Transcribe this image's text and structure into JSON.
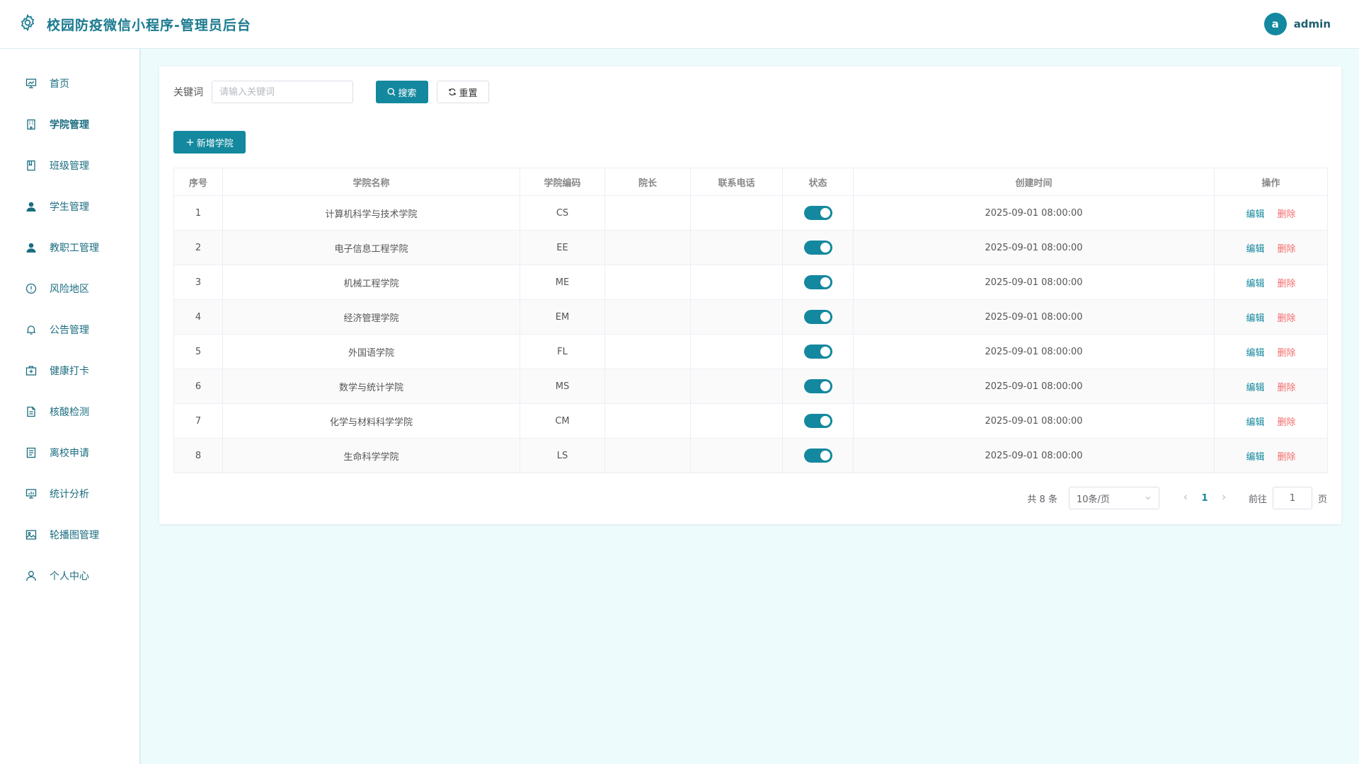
{
  "header": {
    "title": "校园防疫微信小程序-管理员后台",
    "avatar_letter": "a",
    "username": "admin"
  },
  "colors": {
    "primary": "#13889e",
    "danger": "#f56c6c",
    "page_bg": "#eefbfd"
  },
  "sidebar": {
    "items": [
      {
        "label": "首页",
        "icon": "dashboard-icon"
      },
      {
        "label": "学院管理",
        "icon": "building-icon"
      },
      {
        "label": "班级管理",
        "icon": "book-icon"
      },
      {
        "label": "学生管理",
        "icon": "user-icon"
      },
      {
        "label": "教职工管理",
        "icon": "user-icon"
      },
      {
        "label": "风险地区",
        "icon": "warning-circle-icon"
      },
      {
        "label": "公告管理",
        "icon": "bell-icon"
      },
      {
        "label": "健康打卡",
        "icon": "medical-kit-icon"
      },
      {
        "label": "核酸检测",
        "icon": "document-icon"
      },
      {
        "label": "离校申请",
        "icon": "list-document-icon"
      },
      {
        "label": "统计分析",
        "icon": "chart-board-icon"
      },
      {
        "label": "轮播图管理",
        "icon": "image-icon"
      },
      {
        "label": "个人中心",
        "icon": "person-outline-icon"
      }
    ]
  },
  "search": {
    "label": "关键词",
    "placeholder": "请输入关键词",
    "search_btn": "搜索",
    "reset_btn": "重置"
  },
  "toolbar": {
    "add_btn": "新增学院"
  },
  "table": {
    "columns": [
      "序号",
      "学院名称",
      "学院编码",
      "院长",
      "联系电话",
      "状态",
      "创建时间",
      "操作"
    ],
    "rows": [
      {
        "index": "1",
        "name": "计算机科学与技术学院",
        "code": "CS",
        "dean": "",
        "phone": "",
        "enabled": true,
        "created": "2025-09-01 08:00:00"
      },
      {
        "index": "2",
        "name": "电子信息工程学院",
        "code": "EE",
        "dean": "",
        "phone": "",
        "enabled": true,
        "created": "2025-09-01 08:00:00"
      },
      {
        "index": "3",
        "name": "机械工程学院",
        "code": "ME",
        "dean": "",
        "phone": "",
        "enabled": true,
        "created": "2025-09-01 08:00:00"
      },
      {
        "index": "4",
        "name": "经济管理学院",
        "code": "EM",
        "dean": "",
        "phone": "",
        "enabled": true,
        "created": "2025-09-01 08:00:00"
      },
      {
        "index": "5",
        "name": "外国语学院",
        "code": "FL",
        "dean": "",
        "phone": "",
        "enabled": true,
        "created": "2025-09-01 08:00:00"
      },
      {
        "index": "6",
        "name": "数学与统计学院",
        "code": "MS",
        "dean": "",
        "phone": "",
        "enabled": true,
        "created": "2025-09-01 08:00:00"
      },
      {
        "index": "7",
        "name": "化学与材料科学学院",
        "code": "CM",
        "dean": "",
        "phone": "",
        "enabled": true,
        "created": "2025-09-01 08:00:00"
      },
      {
        "index": "8",
        "name": "生命科学学院",
        "code": "LS",
        "dean": "",
        "phone": "",
        "enabled": true,
        "created": "2025-09-01 08:00:00"
      }
    ],
    "edit_label": "编辑",
    "delete_label": "删除"
  },
  "pagination": {
    "total_text": "共 8 条",
    "page_size": "10条/页",
    "current_page": "1",
    "goto_label": "前往",
    "goto_value": "1",
    "page_unit": "页"
  }
}
